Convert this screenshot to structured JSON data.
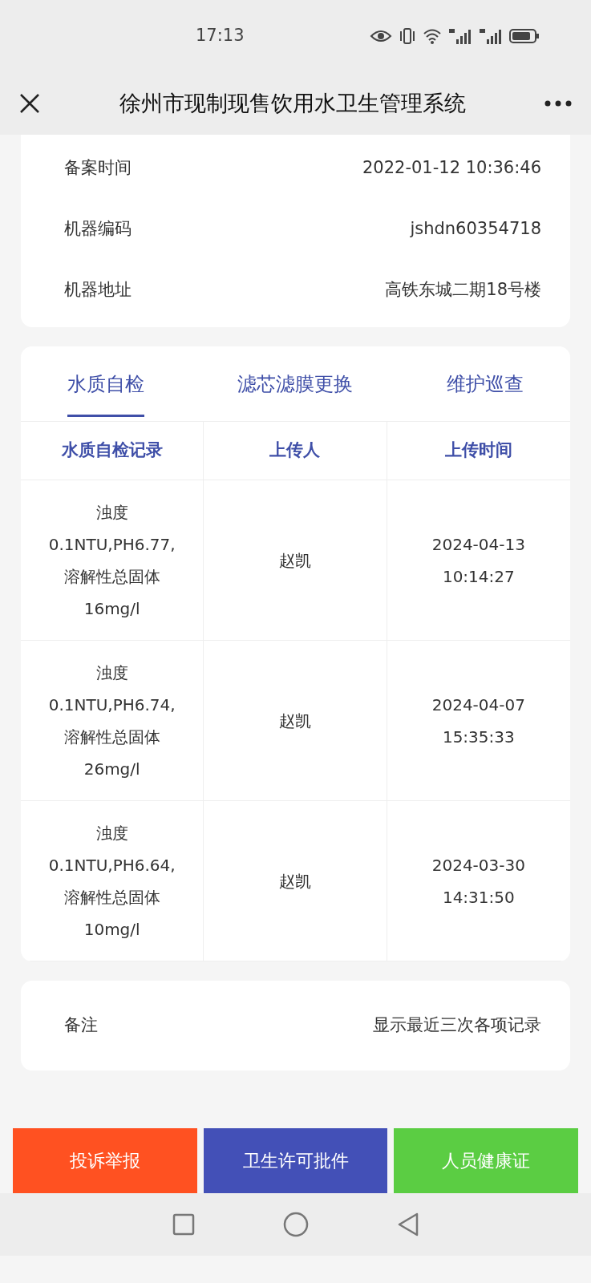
{
  "status_bar": {
    "time": "17:13"
  },
  "header": {
    "title": "徐州市现制现售饮用水卫生管理系统"
  },
  "info": [
    {
      "label": "备案时间",
      "value": "2022-01-12 10:36:46"
    },
    {
      "label": "机器编码",
      "value": "jshdn60354718"
    },
    {
      "label": "机器地址",
      "value": "高铁东城二期18号楼"
    }
  ],
  "tabs": [
    {
      "label": "水质自检",
      "selected": true
    },
    {
      "label": "滤芯滤膜更换",
      "selected": false
    },
    {
      "label": "维护巡查",
      "selected": false
    }
  ],
  "table": {
    "columns": [
      "水质自检记录",
      "上传人",
      "上传时间"
    ],
    "rows": [
      [
        "浊度\n0.1NTU,PH6.77,\n溶解性总固体\n16mg/l",
        "赵凯",
        "2024-04-13\n10:14:27"
      ],
      [
        "浊度\n0.1NTU,PH6.74,\n溶解性总固体\n26mg/l",
        "赵凯",
        "2024-04-07\n15:35:33"
      ],
      [
        "浊度\n0.1NTU,PH6.64,\n溶解性总固体\n10mg/l",
        "赵凯",
        "2024-03-30\n14:31:50"
      ]
    ]
  },
  "remark": {
    "label": "备注",
    "value": "显示最近三次各项记录"
  },
  "buttons": [
    {
      "label": "投诉举报",
      "color": "#ff5121"
    },
    {
      "label": "卫生许可批件",
      "color": "#4350b7"
    },
    {
      "label": "人员健康证",
      "color": "#5bcd43"
    }
  ]
}
